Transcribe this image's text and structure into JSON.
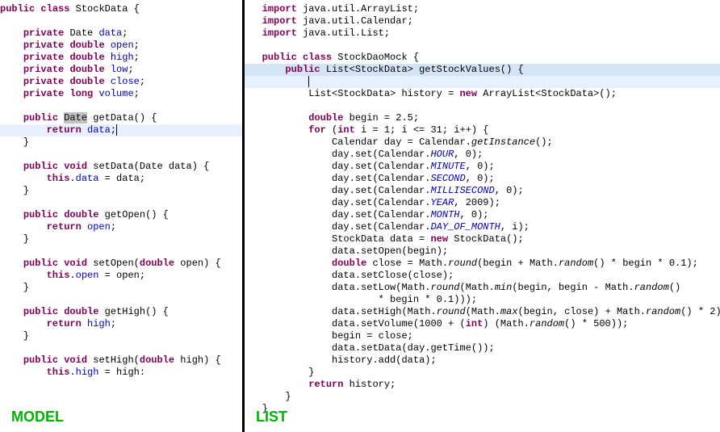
{
  "left": {
    "label": "MODEL",
    "tokens": {
      "public": "public",
      "class": "class",
      "private": "private",
      "void": "void",
      "return": "return",
      "this": "this",
      "double": "double",
      "long": "long",
      "StockData": "StockData",
      "Date": "Date",
      "data": "data",
      "open": "open",
      "high": "high",
      "low": "low",
      "close": "close",
      "volume": "volume",
      "getData": "getData",
      "setData": "setData",
      "getOpen": "getOpen",
      "setOpen": "setOpen",
      "getHigh": "getHigh",
      "setHigh": "setHigh"
    }
  },
  "right": {
    "label": "LIST",
    "tokens": {
      "import": "import",
      "java_util_ArrayList": "java.util.ArrayList",
      "java_util_Calendar": "java.util.Calendar",
      "java_util_List": "java.util.List",
      "public": "public",
      "class": "class",
      "StockDaoMock": "StockDaoMock",
      "List": "List",
      "StockData": "StockData",
      "getStockValues": "getStockValues",
      "history": "history",
      "new": "new",
      "ArrayList": "ArrayList",
      "double": "double",
      "begin": "begin",
      "v25": "2.5",
      "for": "for",
      "int": "int",
      "i": "i",
      "v1": "1",
      "v31": "31",
      "Calendar": "Calendar",
      "day": "day",
      "getInstance": "getInstance",
      "set": "set",
      "HOUR": "HOUR",
      "MINUTE": "MINUTE",
      "SECOND": "SECOND",
      "MILLISECOND": "MILLISECOND",
      "YEAR": "YEAR",
      "MONTH": "MONTH",
      "DAY_OF_MONTH": "DAY_OF_MONTH",
      "v0": "0",
      "v2009": "2009",
      "data": "data",
      "setOpen": "setOpen",
      "close": "close",
      "Math": "Math",
      "round": "round",
      "random": "random",
      "min": "min",
      "max": "max",
      "v01": "0.1",
      "setClose": "setClose",
      "setLow": "setLow",
      "setHigh": "setHigh",
      "setVolume": "setVolume",
      "v1000": "1000",
      "v500": "500",
      "v2": "2",
      "setData": "setData",
      "getTime": "getTime",
      "add": "add",
      "return": "return"
    }
  }
}
